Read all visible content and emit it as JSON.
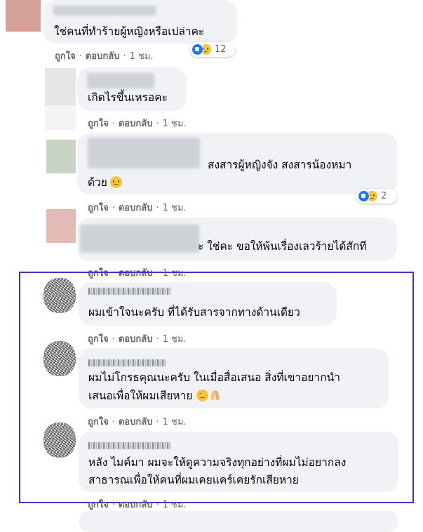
{
  "comments": [
    {
      "text_lines": [
        "ใช่คนที่ทำร้ายผู้หญิงหรือเปล่าคะ"
      ],
      "actions": {
        "like": "ถูกใจ",
        "reply": "ตอบกลับ",
        "time": "1 ชม."
      },
      "reactions": {
        "count": "12",
        "types": [
          "like",
          "sad"
        ]
      }
    },
    {
      "text_lines": [
        "เกิดไรขึ้นเหรอคะ"
      ],
      "actions": {
        "like": "ถูกใจ",
        "reply": "ตอบกลับ",
        "time": "1 ชม."
      }
    },
    {
      "text_lines": [
        "สงสารผู้หญิงจัง สงสารน้องหมา",
        "ด้วย"
      ],
      "emoji": [
        "sad"
      ],
      "actions": {
        "like": "ถูกใจ",
        "reply": "ตอบกลับ",
        "time": "1 ชม."
      },
      "reactions": {
        "count": "2",
        "types": [
          "like",
          "sad"
        ]
      }
    },
    {
      "text_lines": [
        "ะ ใช่คะ ขอให้พ้นเรื่องเลวร้ายได้สักที"
      ],
      "actions": {
        "like": "ถูกใจ",
        "reply": "ตอบกลับ",
        "time": "1 ชม."
      }
    },
    {
      "text_lines": [
        "ผมเข้าใจนะครับ ที่ได้รับสารจากทางด้านเดียว"
      ],
      "actions": {
        "like": "ถูกใจ",
        "reply": "ตอบกลับ",
        "time": "1 ชม."
      }
    },
    {
      "text_lines": [
        "ผมไม่โกรธคุณนะครับ ในเมื่อสื่อเสนอ สิ่งที่เขาอยากนำ",
        "เสนอเพื่อให้ผมเสียหาย"
      ],
      "emoji": [
        "smile",
        "pray"
      ],
      "actions": {
        "like": "ถูกใจ",
        "reply": "ตอบกลับ",
        "time": "1 ชม."
      }
    },
    {
      "text_lines": [
        "หลัง ไมค์มา ผมจะให้ดูความจริงทุกอย่างที่ผมไม่อยากลง",
        "สาธารณเพื่อให้คนที่ผมเคยแคร์เคยรักเสียหาย"
      ],
      "actions": {
        "like": "ถูกใจ",
        "reply": "ตอบกลับ",
        "time": "1 ชม."
      }
    }
  ],
  "colors": {
    "bubble": "#f0f2f5",
    "meta_text": "#65676b",
    "highlight_border": "#3b36c9",
    "like_blue": "#1877f2"
  }
}
